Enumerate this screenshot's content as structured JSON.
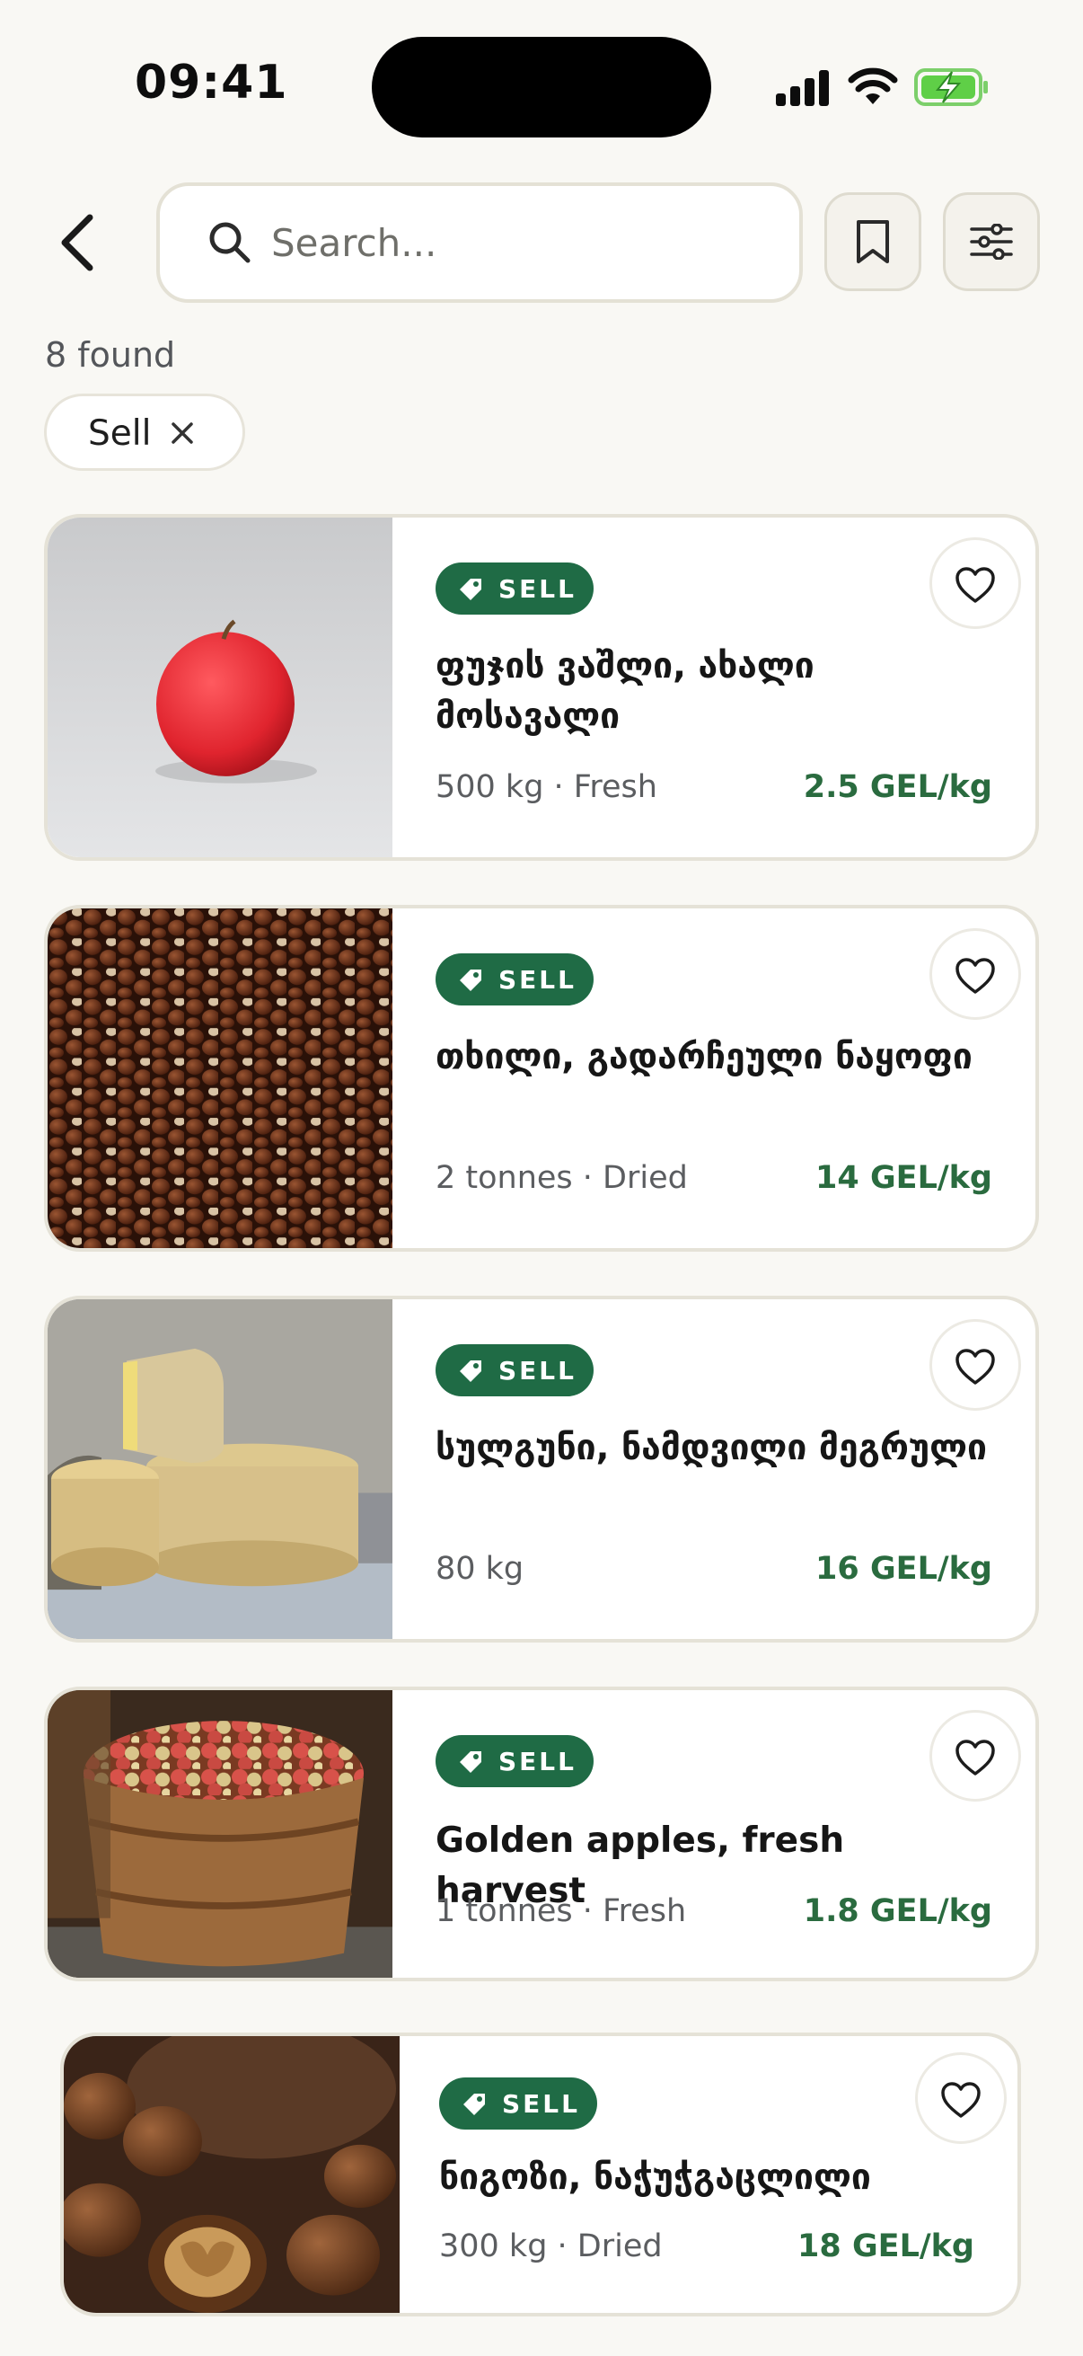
{
  "status_bar": {
    "time": "09:41"
  },
  "search": {
    "placeholder": "Search..."
  },
  "results": {
    "count_label": "8 found"
  },
  "filters": [
    {
      "label": "Sell"
    }
  ],
  "colors": {
    "accent": "#1f6b45",
    "price": "#2a6b3f",
    "background": "#f9f8f4"
  },
  "listings": [
    {
      "badge": "SELL",
      "title": "ფუჯის ვაშლი, ახალი მოსავალი",
      "meta": "500 kg · Fresh",
      "price": "2.5 GEL/kg",
      "image": "red-apple-photo"
    },
    {
      "badge": "SELL",
      "title": "თხილი, გადარჩეული ნაყოფი",
      "meta": "2 tonnes · Dried",
      "price": "14 GEL/kg",
      "image": "hazelnuts-photo"
    },
    {
      "badge": "SELL",
      "title": "სულგუნი, ნამდვილი მეგრული",
      "meta": "80 kg",
      "price": "16 GEL/kg",
      "image": "cheese-wheels-photo"
    },
    {
      "badge": "SELL",
      "title": "Golden apples, fresh harvest",
      "meta": "1 tonnes · Fresh",
      "price": "1.8 GEL/kg",
      "image": "apple-basket-photo"
    },
    {
      "badge": "SELL",
      "title": "ნიგოზი, ნაჭუჭგაცლილი",
      "meta": "300 kg · Dried",
      "price": "18 GEL/kg",
      "image": "walnuts-photo"
    }
  ]
}
